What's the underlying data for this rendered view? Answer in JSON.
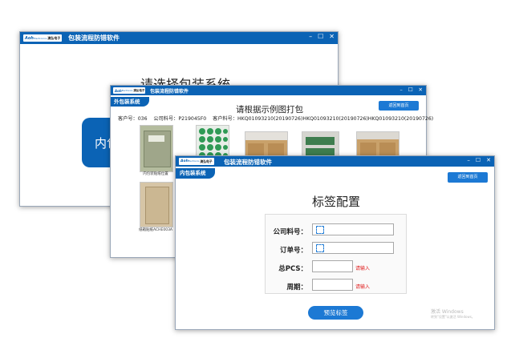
{
  "window1": {
    "logo_brand": "Aoh",
    "logo_sub": "Electronics",
    "logo_cn": "澳弘电子",
    "title": "包装流程防错软件",
    "heading": "请选择包装系统",
    "big_button_label": "内包"
  },
  "window2": {
    "logo_brand": "Aoh",
    "logo_sub": "Electronics",
    "logo_cn": "澳弘电子",
    "title": "包装流程防错软件",
    "tag": "外包装系统",
    "heading": "请根据示例图打包",
    "back_button": "返回到首页",
    "info": "客户号：036    公司料号：P219045F0    客户料号：HKQ01093210(20190726)HKQ01093210(20190726)HKQ01093210(20190726)",
    "photos": [
      {
        "caption": "内包装贴纸位置"
      },
      {
        "caption": ""
      },
      {
        "caption": ""
      },
      {
        "caption": ""
      },
      {
        "caption": ""
      },
      {
        "caption": "纸箱贴纸ACHE003A"
      }
    ]
  },
  "window3": {
    "logo_brand": "Aoh",
    "logo_sub": "Electronics",
    "logo_cn": "澳弘电子",
    "title": "包装流程防错软件",
    "tag": "内包装系统",
    "back_button": "返回到首页",
    "heading": "标签配置",
    "fields": [
      {
        "label": "公司料号：",
        "value": "",
        "required_text": ""
      },
      {
        "label": "订单号：",
        "value": "",
        "required_text": ""
      },
      {
        "label": "总PCS：",
        "value": "",
        "required_text": "请输入"
      },
      {
        "label": "周期：",
        "value": "",
        "required_text": "请输入"
      }
    ],
    "preview_button": "预览标签",
    "watermark_line1": "激活 Windows",
    "watermark_line2": "转到\"设置\"以激活 Windows。"
  },
  "colors": {
    "titlebar": "#0b63b5",
    "accent_button": "#1c79d4",
    "required": "#e02020"
  },
  "icons": [
    "minimize-icon",
    "maximize-icon",
    "close-icon",
    "scan-icon"
  ]
}
